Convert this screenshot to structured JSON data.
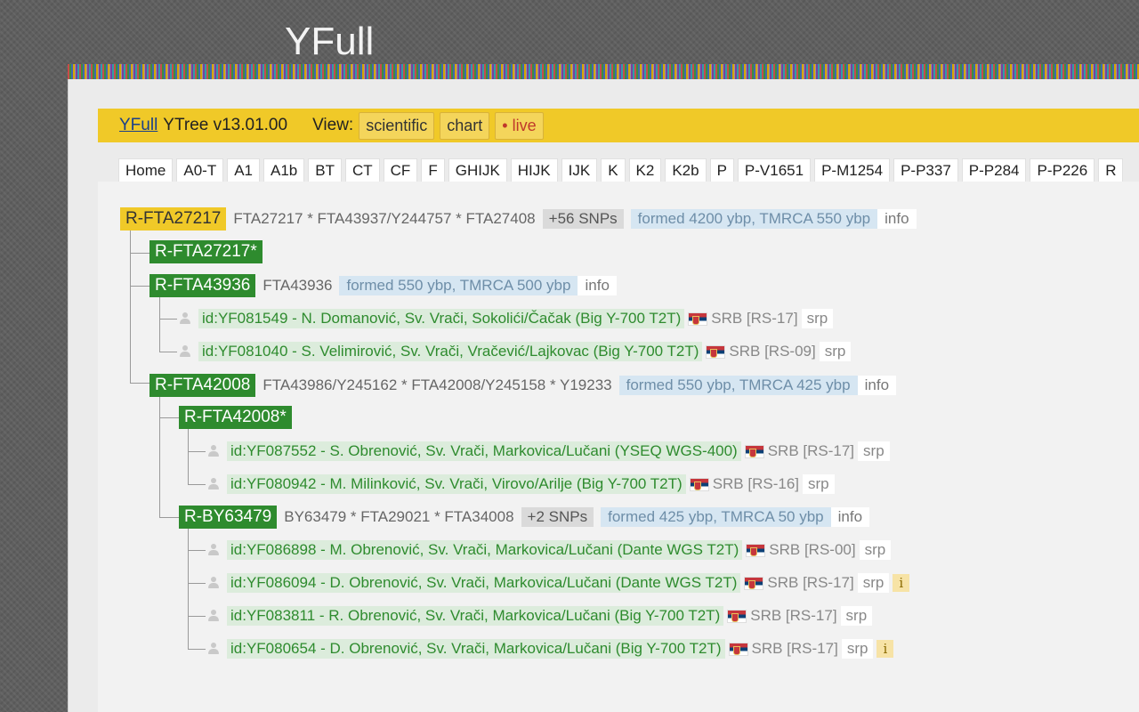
{
  "site": {
    "title": "YFull"
  },
  "topbar": {
    "brand": "YFull",
    "version": "YTree v13.01.00",
    "view_label": "View:",
    "views": [
      "scientific",
      "chart",
      "• live"
    ]
  },
  "tabs": [
    "Home",
    "A0-T",
    "A1",
    "A1b",
    "BT",
    "CT",
    "CF",
    "F",
    "GHIJK",
    "HIJK",
    "IJK",
    "K",
    "K2",
    "K2b",
    "P",
    "P-V1651",
    "P-M1254",
    "P-P337",
    "P-P284",
    "P-P226",
    "R"
  ],
  "tree": {
    "root": {
      "name": "R-FTA27217",
      "snps": "FTA27217 * FTA43937/Y244757 * FTA27408",
      "extra": "+56 SNPs",
      "formed": "formed 4200 ybp, TMRCA 550 ybp",
      "info": "info"
    },
    "n1": {
      "name": "R-FTA27217*"
    },
    "n2": {
      "name": "R-FTA43936",
      "snps": "FTA43936",
      "formed": "formed 550 ybp, TMRCA 500 ybp",
      "info": "info",
      "samples": [
        {
          "label": "id:YF081549 - N. Domanović, Sv. Vrači, Sokolići/Čačak (Big Y-700 T2T)",
          "country": "SRB [RS-17]",
          "lang": "srp"
        },
        {
          "label": "id:YF081040 - S. Velimirović, Sv. Vrači, Vračević/Lajkovac (Big Y-700 T2T)",
          "country": "SRB [RS-09]",
          "lang": "srp"
        }
      ]
    },
    "n3": {
      "name": "R-FTA42008",
      "snps": "FTA43986/Y245162 * FTA42008/Y245158 * Y19233",
      "formed": "formed 550 ybp, TMRCA 425 ybp",
      "info": "info"
    },
    "n3a": {
      "name": "R-FTA42008*",
      "samples": [
        {
          "label": "id:YF087552 - S. Obrenović, Sv. Vrači, Markovica/Lučani (YSEQ WGS-400)",
          "country": "SRB [RS-17]",
          "lang": "srp"
        },
        {
          "label": "id:YF080942 - M. Milinković, Sv. Vrači, Virovo/Arilje (Big Y-700 T2T)",
          "country": "SRB [RS-16]",
          "lang": "srp"
        }
      ]
    },
    "n3b": {
      "name": "R-BY63479",
      "snps": "BY63479 * FTA29021 * FTA34008",
      "extra": "+2 SNPs",
      "formed": "formed 425 ybp, TMRCA 50 ybp",
      "info": "info",
      "samples": [
        {
          "label": "id:YF086898 - M. Obrenović, Sv. Vrači, Markovica/Lučani (Dante WGS T2T)",
          "country": "SRB [RS-00]",
          "lang": "srp",
          "badge": ""
        },
        {
          "label": "id:YF086094 - D. Obrenović, Sv. Vrači, Markovica/Lučani (Dante WGS T2T)",
          "country": "SRB [RS-17]",
          "lang": "srp",
          "badge": "i"
        },
        {
          "label": "id:YF083811 - R. Obrenović, Sv. Vrači, Markovica/Lučani (Big Y-700 T2T)",
          "country": "SRB [RS-17]",
          "lang": "srp",
          "badge": ""
        },
        {
          "label": "id:YF080654 - D. Obrenović, Sv. Vrači, Markovica/Lučani (Big Y-700 T2T)",
          "country": "SRB [RS-17]",
          "lang": "srp",
          "badge": "i"
        }
      ]
    }
  }
}
